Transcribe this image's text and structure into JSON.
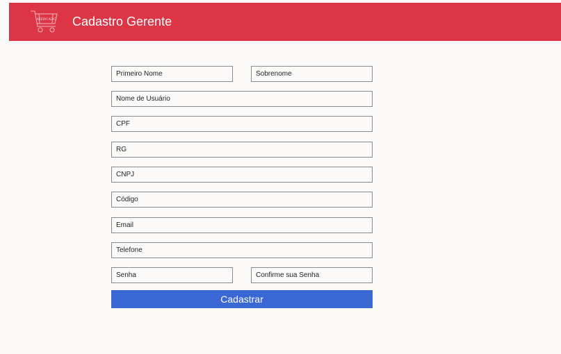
{
  "header": {
    "title": "Cadastro Gerente",
    "logo_icon": "shopping-cart-icon",
    "logo_text": "MERCADO",
    "background": "#dc3545"
  },
  "form": {
    "first_name": {
      "placeholder": "Primeiro Nome"
    },
    "last_name": {
      "placeholder": "Sobrenome"
    },
    "username": {
      "placeholder": "Nome de Usuário"
    },
    "cpf": {
      "placeholder": "CPF"
    },
    "rg": {
      "placeholder": "RG"
    },
    "cnpj": {
      "placeholder": "CNPJ"
    },
    "code": {
      "placeholder": "Código"
    },
    "email": {
      "placeholder": "Email"
    },
    "phone": {
      "placeholder": "Telefone"
    },
    "password": {
      "placeholder": "Senha"
    },
    "confirm_password": {
      "placeholder": "Confirme sua Senha"
    },
    "submit_label": "Cadastrar",
    "submit_color": "#3a67d4"
  }
}
